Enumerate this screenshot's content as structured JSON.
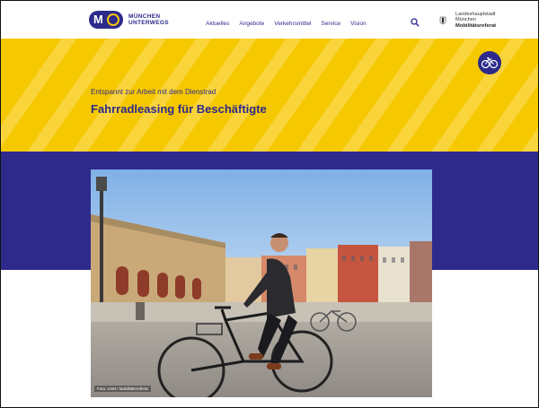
{
  "header": {
    "logo_line1": "MÜNCHEN",
    "logo_line2": "UNTERWEGS",
    "nav": [
      "Aktuelles",
      "Angebote",
      "Verkehrsmittel",
      "Service",
      "Vision"
    ],
    "city_line1": "Landeshauptstadt",
    "city_line2": "München",
    "city_line3": "Mobilitätsreferat",
    "icons": [
      "search-icon",
      "munich-crest-icon"
    ]
  },
  "hero": {
    "subtitle": "Entspannt zur Arbeit mit dem Dienstrad",
    "title": "Fahrradleasing für Beschäftigte",
    "badge_icon": "bicycle-icon"
  },
  "photo": {
    "credit": "Foto: LHM / Mobilitätsreferat"
  },
  "colors": {
    "brand_purple": "#2d2a8c",
    "brand_yellow": "#f6c800"
  }
}
